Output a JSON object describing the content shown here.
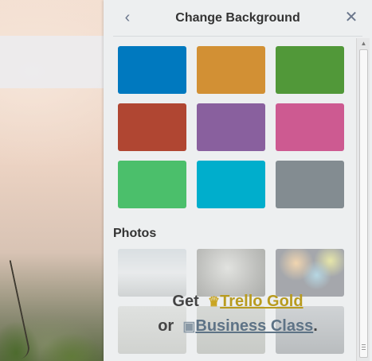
{
  "panel": {
    "title": "Change Background",
    "back_icon": "‹",
    "close_icon": "✕"
  },
  "colors": {
    "blue": "#0079bf",
    "orange": "#d29034",
    "green": "#519839",
    "red": "#b04632",
    "purple": "#89609e",
    "pink": "#cd5a91",
    "lime": "#4bbf6b",
    "sky": "#00aecc",
    "grey": "#838c91"
  },
  "photos": {
    "heading": "Photos"
  },
  "upsell": {
    "get": "Get",
    "gold_icon": "♛",
    "gold": "Trello Gold",
    "or": "or",
    "bc_icon": "▣",
    "business_class": "Business Class",
    "period": "."
  },
  "scrollbar": {
    "up_arrow": "▲"
  }
}
